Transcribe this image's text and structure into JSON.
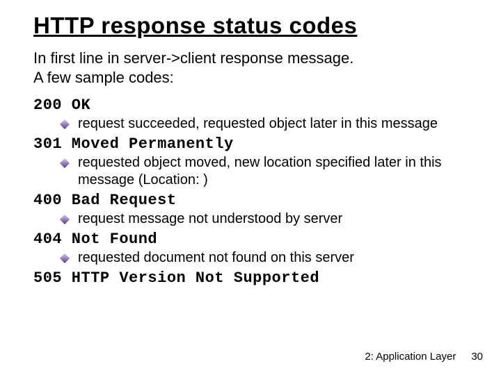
{
  "title": "HTTP response status codes",
  "lead_line1": "In first line in server->client response message.",
  "lead_line2": "A few sample codes:",
  "codes": [
    {
      "code": "200 OK",
      "explain": "request succeeded, requested object later in this message"
    },
    {
      "code": "301 Moved Permanently",
      "explain": "requested object moved, new location specified later in this message (Location: )"
    },
    {
      "code": "400 Bad Request",
      "explain": "request message not understood by server"
    },
    {
      "code": "404 Not Found",
      "explain": "requested document not found on this server"
    },
    {
      "code": "505 HTTP Version Not Supported",
      "explain": null
    }
  ],
  "footer": {
    "chapter": "2: Application Layer",
    "page": "30"
  }
}
